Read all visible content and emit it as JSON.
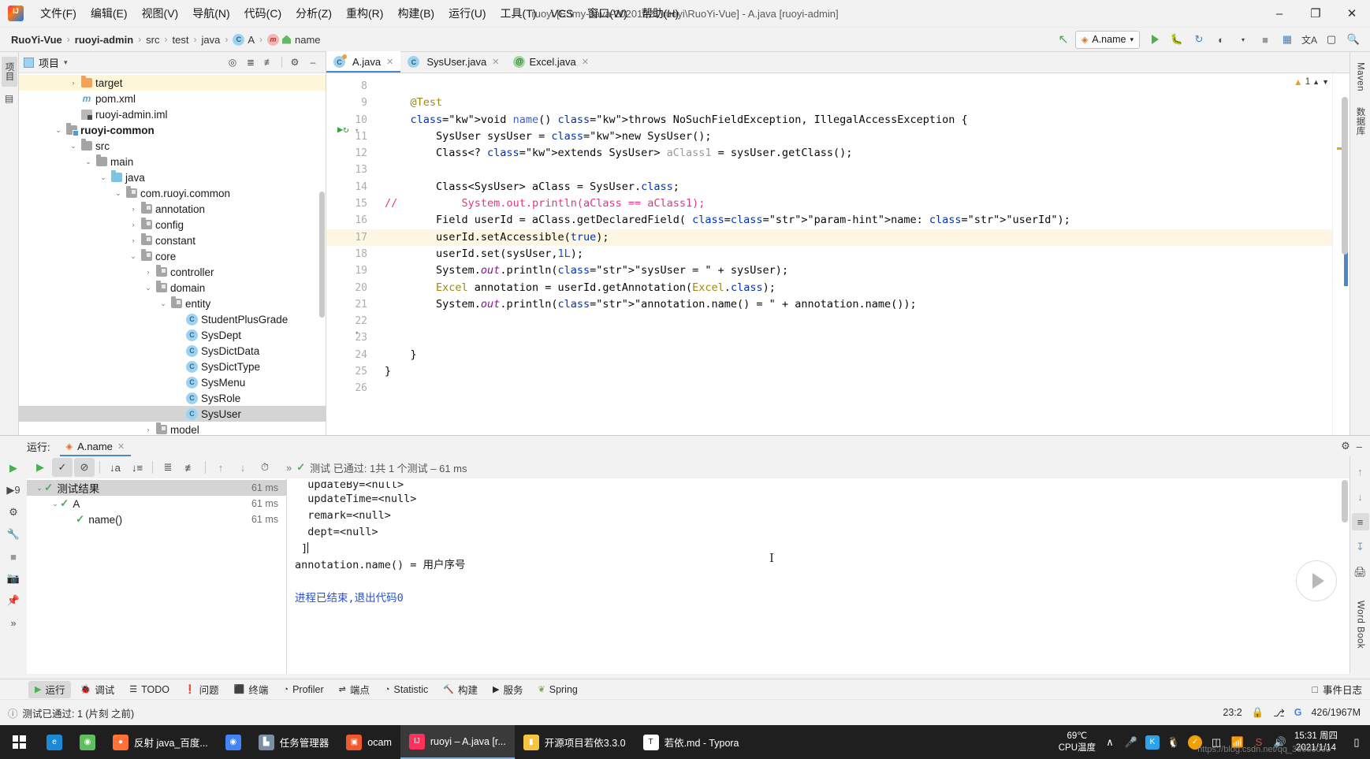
{
  "window": {
    "title": "ruoyi [E:\\my-Java-20201221\\ruoyi\\RuoYi-Vue] - A.java [ruoyi-admin]",
    "minimize": "–",
    "maximize": "❐",
    "close": "✕"
  },
  "menu": {
    "items": [
      {
        "label": "文件(F)"
      },
      {
        "label": "编辑(E)"
      },
      {
        "label": "视图(V)"
      },
      {
        "label": "导航(N)"
      },
      {
        "label": "代码(C)"
      },
      {
        "label": "分析(Z)"
      },
      {
        "label": "重构(R)"
      },
      {
        "label": "构建(B)"
      },
      {
        "label": "运行(U)"
      },
      {
        "label": "工具(T)"
      },
      {
        "label": "VCS"
      },
      {
        "label": "窗口(W)"
      },
      {
        "label": "帮助(H)"
      }
    ]
  },
  "breadcrumb": {
    "items": [
      "RuoYi-Vue",
      "ruoyi-admin",
      "src",
      "test",
      "java",
      "A",
      "name"
    ],
    "separator": "›"
  },
  "nav_toolbar": {
    "run_config": "A.name",
    "dropdown_caret": "▾",
    "back_arrow": "↖",
    "run_title": "Run",
    "debug_title": "Debug",
    "coverage_title": "Run with Coverage",
    "profile_title": "Profile",
    "stop_title": "Stop",
    "build_title": "Build",
    "translate_title": "文A",
    "terminal_title": "Terminal",
    "search_title": "Search"
  },
  "left_rail": {
    "tabs": [
      {
        "label": "项目",
        "selected": true
      }
    ],
    "icons": [
      "structure-icon",
      "favorites-icon"
    ]
  },
  "right_rail": {
    "tabs": [
      "Maven",
      "数据库"
    ]
  },
  "project_pane": {
    "title": "项目",
    "caret": "▾",
    "header_icons": [
      "target-icon",
      "expand-all-icon",
      "collapse-all-icon",
      "settings-icon",
      "hide-icon"
    ],
    "tree": [
      {
        "label": "target",
        "indent": 3,
        "arrow": "›",
        "icon": "folder-orange",
        "bold": false,
        "highlight": true
      },
      {
        "label": "pom.xml",
        "indent": 3,
        "arrow": "",
        "icon": "xml",
        "bold": false
      },
      {
        "label": "ruoyi-admin.iml",
        "indent": 3,
        "arrow": "",
        "icon": "iml",
        "bold": false
      },
      {
        "label": "ruoyi-common",
        "indent": 2,
        "arrow": "⌄",
        "icon": "folder-module",
        "bold": true
      },
      {
        "label": "src",
        "indent": 3,
        "arrow": "⌄",
        "icon": "folder-gray",
        "bold": false
      },
      {
        "label": "main",
        "indent": 4,
        "arrow": "⌄",
        "icon": "folder-gray",
        "bold": false
      },
      {
        "label": "java",
        "indent": 5,
        "arrow": "⌄",
        "icon": "folder-blue",
        "bold": false
      },
      {
        "label": "com.ruoyi.common",
        "indent": 6,
        "arrow": "⌄",
        "icon": "folder-pkg",
        "bold": false
      },
      {
        "label": "annotation",
        "indent": 7,
        "arrow": "›",
        "icon": "folder-pkg",
        "bold": false
      },
      {
        "label": "config",
        "indent": 7,
        "arrow": "›",
        "icon": "folder-pkg",
        "bold": false
      },
      {
        "label": "constant",
        "indent": 7,
        "arrow": "›",
        "icon": "folder-pkg",
        "bold": false
      },
      {
        "label": "core",
        "indent": 7,
        "arrow": "⌄",
        "icon": "folder-pkg",
        "bold": false
      },
      {
        "label": "controller",
        "indent": 8,
        "arrow": "›",
        "icon": "folder-pkg",
        "bold": false
      },
      {
        "label": "domain",
        "indent": 8,
        "arrow": "⌄",
        "icon": "folder-pkg",
        "bold": false
      },
      {
        "label": "entity",
        "indent": 9,
        "arrow": "⌄",
        "icon": "folder-pkg",
        "bold": false
      },
      {
        "label": "StudentPlusGrade",
        "indent": 10,
        "arrow": "",
        "icon": "class",
        "bold": false
      },
      {
        "label": "SysDept",
        "indent": 10,
        "arrow": "",
        "icon": "class",
        "bold": false
      },
      {
        "label": "SysDictData",
        "indent": 10,
        "arrow": "",
        "icon": "class",
        "bold": false
      },
      {
        "label": "SysDictType",
        "indent": 10,
        "arrow": "",
        "icon": "class",
        "bold": false
      },
      {
        "label": "SysMenu",
        "indent": 10,
        "arrow": "",
        "icon": "class",
        "bold": false
      },
      {
        "label": "SysRole",
        "indent": 10,
        "arrow": "",
        "icon": "class",
        "bold": false
      },
      {
        "label": "SysUser",
        "indent": 10,
        "arrow": "",
        "icon": "class",
        "bold": false,
        "selected": true
      },
      {
        "label": "model",
        "indent": 8,
        "arrow": "›",
        "icon": "folder-pkg",
        "bold": false
      }
    ]
  },
  "editor": {
    "tabs": [
      {
        "label": "A.java",
        "icon": "class-test-icon",
        "active": true,
        "close": "✕"
      },
      {
        "label": "SysUser.java",
        "icon": "class-icon",
        "active": false,
        "close": "✕"
      },
      {
        "label": "Excel.java",
        "icon": "annotation-icon",
        "active": false,
        "close": "✕"
      }
    ],
    "first_line_number": 8,
    "line_numbers": [
      8,
      9,
      10,
      11,
      12,
      13,
      14,
      15,
      16,
      17,
      18,
      19,
      20,
      21,
      22,
      23,
      24,
      25,
      26
    ],
    "highlight_line": 17,
    "warning_count": "1",
    "warning_icon": "warning-triangle-icon",
    "lines": [
      {
        "n": 8,
        "text": ""
      },
      {
        "n": 9,
        "text": "    @Test"
      },
      {
        "n": 10,
        "text": "    void name() throws NoSuchFieldException, IllegalAccessException {"
      },
      {
        "n": 11,
        "text": "        SysUser sysUser = new SysUser();"
      },
      {
        "n": 12,
        "text": "        Class<? extends SysUser> aClass1 = sysUser.getClass();"
      },
      {
        "n": 13,
        "text": ""
      },
      {
        "n": 14,
        "text": "        Class<SysUser> aClass = SysUser.class;"
      },
      {
        "n": 15,
        "text": "//          System.out.println(aClass == aClass1);"
      },
      {
        "n": 16,
        "text": "        Field userId = aClass.getDeclaredField( name: \"userId\");"
      },
      {
        "n": 17,
        "text": "        userId.setAccessible(true);"
      },
      {
        "n": 18,
        "text": "        userId.set(sysUser,1L);"
      },
      {
        "n": 19,
        "text": "        System.out.println(\"sysUser = \" + sysUser);"
      },
      {
        "n": 20,
        "text": "        Excel annotation = userId.getAnnotation(Excel.class);"
      },
      {
        "n": 21,
        "text": "        System.out.println(\"annotation.name() = \" + annotation.name());"
      },
      {
        "n": 22,
        "text": ""
      },
      {
        "n": 23,
        "text": ""
      },
      {
        "n": 24,
        "text": "    }"
      },
      {
        "n": 25,
        "text": "}"
      },
      {
        "n": 26,
        "text": ""
      }
    ]
  },
  "run_panel": {
    "label": "运行:",
    "tab": "A.name",
    "tab_close": "✕",
    "settings_icon": "gear-icon",
    "minimize_icon": "minimize-icon",
    "toolbar_icons": [
      "rerun-icon",
      "show-passed-icon",
      "ignore-icon",
      "sort-alpha-icon",
      "sort-duration-icon",
      "expand-all-icon",
      "collapse-all-icon",
      "prev-icon",
      "next-icon",
      "history-icon"
    ],
    "overflow": "»",
    "status_text": "测试 已通过: 1共 1 个测试 – 61 ms",
    "sidebar_icons": [
      "resume-icon",
      "debug-icon",
      "wrench-icon",
      "stop-icon",
      "camera-icon",
      "pin-icon",
      "more-icon"
    ],
    "tests": [
      {
        "label": "测试结果",
        "time": "61 ms",
        "indent": 0,
        "arrow": "⌄",
        "selected": true
      },
      {
        "label": "A",
        "time": "61 ms",
        "indent": 1,
        "arrow": "⌄",
        "selected": false
      },
      {
        "label": "name()",
        "time": "61 ms",
        "indent": 2,
        "arrow": "",
        "selected": false
      }
    ],
    "console": [
      {
        "text": "  updateBy=<null>",
        "link": false,
        "clipped": true
      },
      {
        "text": "  updateTime=<null>",
        "link": false
      },
      {
        "text": "  remark=<null>",
        "link": false
      },
      {
        "text": "  dept=<null>",
        "link": false
      },
      {
        "text": " ]",
        "link": false,
        "caret": true
      },
      {
        "text": "annotation.name() = 用户序号",
        "link": false
      },
      {
        "text": "",
        "link": false
      },
      {
        "text": "进程已结束,退出代码0",
        "link": true
      }
    ]
  },
  "tool_strip": {
    "items": [
      {
        "label": "运行",
        "icon": "play-icon",
        "active": true
      },
      {
        "label": "调试",
        "icon": "bug-icon",
        "active": false
      },
      {
        "label": "TODO",
        "icon": "todo-icon",
        "active": false
      },
      {
        "label": "问题",
        "icon": "problem-icon",
        "active": false
      },
      {
        "label": "终端",
        "icon": "terminal-icon",
        "active": false
      },
      {
        "label": "Profiler",
        "icon": "profiler-icon",
        "active": false
      },
      {
        "label": "端点",
        "icon": "endpoints-icon",
        "active": false
      },
      {
        "label": "Statistic",
        "icon": "statistic-icon",
        "active": false
      },
      {
        "label": "构建",
        "icon": "build-icon",
        "active": false
      },
      {
        "label": "服务",
        "icon": "services-icon",
        "active": false
      },
      {
        "label": "Spring",
        "icon": "spring-icon",
        "active": false
      }
    ],
    "right_label": "事件日志",
    "right_icon": "event-log-icon"
  },
  "statusbar": {
    "message": "测试已通过: 1 (片刻 之前)",
    "message_icon": "info-icon",
    "caret_position": "23:2",
    "lock_icon": "lock-icon",
    "branch_icon": "branch-icon",
    "google_icon": "G",
    "memory": "426/1967M"
  },
  "taskbar": {
    "start_icon": "windows-start-icon",
    "apps": [
      {
        "label": "",
        "icon": "edge-icon",
        "color": "#1b8ad6",
        "glyph": "e",
        "active": false
      },
      {
        "label": "",
        "icon": "browser360-icon",
        "color": "#5fbf5f",
        "glyph": "◉",
        "active": false
      },
      {
        "label": "反射 java_百度...",
        "icon": "firefox-icon",
        "color": "#ff7139",
        "glyph": "●",
        "active": false
      },
      {
        "label": "",
        "icon": "chrome-icon",
        "color": "#4285f4",
        "glyph": "◉",
        "active": false
      },
      {
        "label": "任务管理器",
        "icon": "task-manager-icon",
        "color": "#7a8fa6",
        "glyph": "▙",
        "active": false
      },
      {
        "label": "ocam",
        "icon": "ocam-icon",
        "color": "#f0592b",
        "glyph": "▣",
        "active": false
      },
      {
        "label": "ruoyi – A.java [r...",
        "icon": "intellij-icon",
        "color": "#fe315d",
        "glyph": "IJ",
        "active": true
      },
      {
        "label": "开源项目若依3.3.0",
        "icon": "folder-icon",
        "color": "#f5c542",
        "glyph": "▮",
        "active": false
      },
      {
        "label": "若依.md - Typora",
        "icon": "typora-icon",
        "color": "#ffffff",
        "glyph": "T",
        "active": false
      }
    ],
    "cpu_temp": "69℃",
    "cpu_label": "CPU温度",
    "tray_expand": "∧",
    "tray_icons": [
      "mic-icon",
      "kugou-icon",
      "qq-icon",
      "shield-icon",
      "battery-icon",
      "network-icon",
      "sogou-icon",
      "volume-icon"
    ],
    "clock_time": "15:31 周四",
    "clock_date": "2021/1/14",
    "watermark": "https://blog.csdn.net/qq_33608000"
  }
}
